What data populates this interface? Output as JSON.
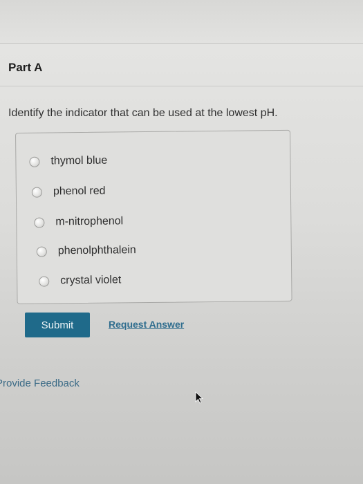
{
  "part": {
    "title": "Part A"
  },
  "question": {
    "text": "Identify the indicator that can be used at the lowest pH."
  },
  "choices": [
    {
      "label": "thymol blue",
      "selected": false
    },
    {
      "label": "phenol red",
      "selected": false
    },
    {
      "label": "m-nitrophenol",
      "selected": false
    },
    {
      "label": "phenolphthalein",
      "selected": false
    },
    {
      "label": "crystal violet",
      "selected": false
    }
  ],
  "actions": {
    "submit_label": "Submit",
    "request_answer_label": "Request Answer"
  },
  "footer": {
    "feedback_label": "Provide Feedback"
  },
  "colors": {
    "submit_bg": "#1f6a8a",
    "link": "#2f6d8e"
  }
}
